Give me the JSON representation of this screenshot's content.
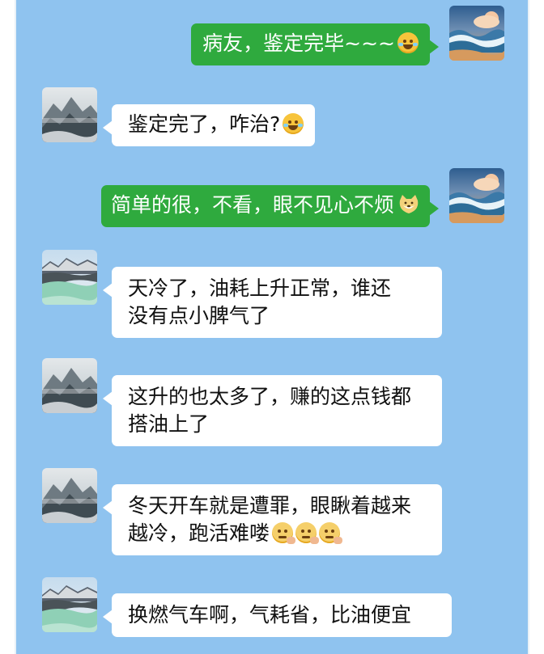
{
  "colors": {
    "background": "#8fc3ef",
    "sent_bubble": "#2faa3e",
    "received_bubble": "#ffffff"
  },
  "messages": [
    {
      "side": "right",
      "text": "病友，鉴定完毕~~~",
      "emoji": "laughing-with-tears-emoji",
      "avatar": "ocean-wave-avatar"
    },
    {
      "side": "left",
      "text": "鉴定完了，咋治?",
      "emoji": "laughing-with-tears-emoji",
      "avatar": "misty-mountain-avatar"
    },
    {
      "side": "right",
      "text": "简单的很，不看，眼不见心不烦",
      "emoji": "doge-emoji",
      "avatar": "ocean-wave-avatar"
    },
    {
      "side": "left",
      "lines": [
        "天冷了，油耗上升正常，谁还",
        "没有点小脾气了"
      ],
      "avatar": "snowy-lake-avatar"
    },
    {
      "side": "left",
      "lines": [
        "这升的也太多了，赚的这点钱都",
        "搭油上了"
      ],
      "avatar": "misty-mountain-avatar"
    },
    {
      "side": "left",
      "lines": [
        "冬天开车就是遭罪，眼瞅着越来",
        "越冷，跑活难喽"
      ],
      "emoji": "cold-emoji",
      "emoji_count": 3,
      "avatar": "misty-mountain-avatar"
    },
    {
      "side": "left",
      "text": "换燃气车啊，气耗省，比油便宜",
      "avatar": "snowy-lake-avatar"
    }
  ]
}
